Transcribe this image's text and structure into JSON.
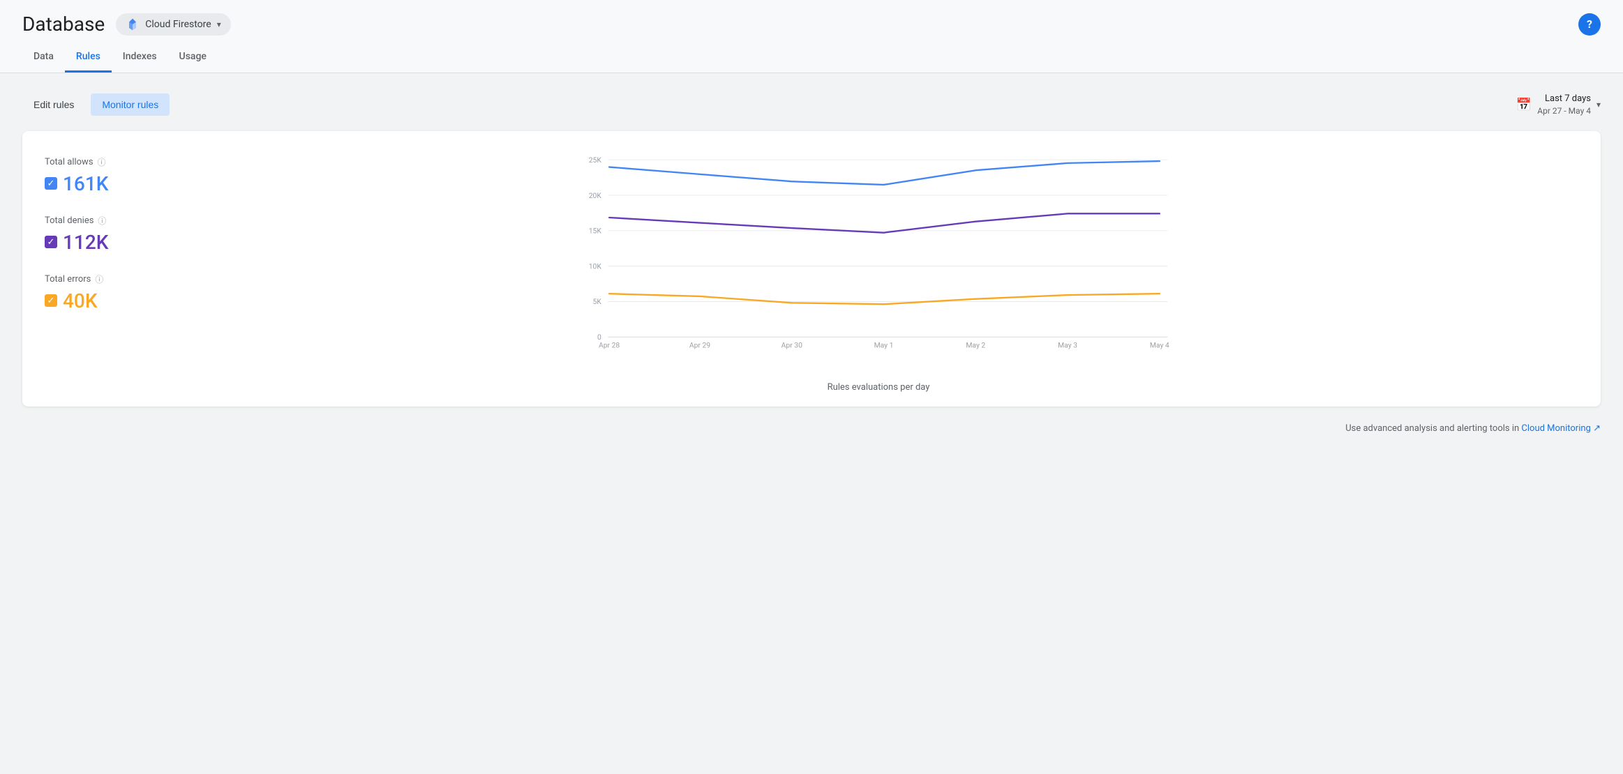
{
  "header": {
    "title": "Database",
    "product": "Cloud Firestore",
    "help_label": "?"
  },
  "nav": {
    "tabs": [
      {
        "id": "data",
        "label": "Data",
        "active": false
      },
      {
        "id": "rules",
        "label": "Rules",
        "active": true
      },
      {
        "id": "indexes",
        "label": "Indexes",
        "active": false
      },
      {
        "id": "usage",
        "label": "Usage",
        "active": false
      }
    ]
  },
  "toolbar": {
    "edit_rules_label": "Edit rules",
    "monitor_rules_label": "Monitor rules",
    "date_range_title": "Last 7 days",
    "date_range_sub": "Apr 27 - May 4"
  },
  "chart": {
    "title": "Rules evaluations per day",
    "y_labels": [
      "25K",
      "20K",
      "15K",
      "10K",
      "5K",
      "0"
    ],
    "x_labels": [
      "Apr 28",
      "Apr 29",
      "Apr 30",
      "May 1",
      "May 2",
      "May 3",
      "May 4"
    ],
    "legend": [
      {
        "id": "allows",
        "label": "Total allows",
        "value": "161K",
        "color_class": "color-blue",
        "text_class": "text-blue",
        "checked": true
      },
      {
        "id": "denies",
        "label": "Total denies",
        "value": "112K",
        "color_class": "color-purple",
        "text_class": "text-purple",
        "checked": true
      },
      {
        "id": "errors",
        "label": "Total errors",
        "value": "40K",
        "color_class": "color-yellow",
        "text_class": "text-yellow",
        "checked": true
      }
    ]
  },
  "footer": {
    "note_prefix": "Use advanced analysis and alerting tools in ",
    "link_text": "Cloud Monitoring",
    "link_icon": "↗"
  }
}
